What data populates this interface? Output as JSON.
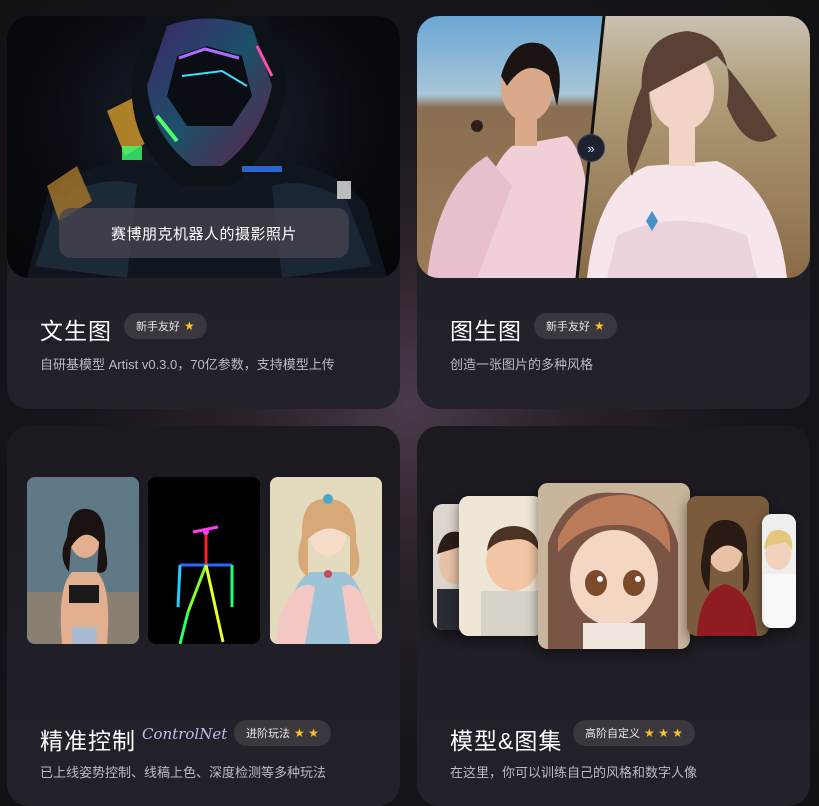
{
  "cards": [
    {
      "title": "文生图",
      "badge": "新手友好",
      "stars": "★",
      "description": "自研基模型 Artist v0.3.0，70亿参数，支持模型上传",
      "image_caption": "赛博朋克机器人的摄影照片"
    },
    {
      "title": "图生图",
      "badge": "新手友好",
      "stars": "★",
      "description": "创造一张图片的多种风格",
      "compare_icon": "double-chevron-right-icon"
    },
    {
      "title": "精准控制",
      "subtitle": "ControlNet",
      "badge": "进阶玩法",
      "stars": "★ ★",
      "description": "已上线姿势控制、线稿上色、深度检测等多种玩法"
    },
    {
      "title": "模型&图集",
      "badge": "高阶自定义",
      "stars": "★ ★ ★",
      "description": "在这里，你可以训练自己的风格和数字人像"
    }
  ],
  "colors": {
    "star": "#ffc21c",
    "badge_bg": "#3a373e",
    "card_bg": "#1c1a20",
    "controlnet": "#c8b6f0"
  }
}
